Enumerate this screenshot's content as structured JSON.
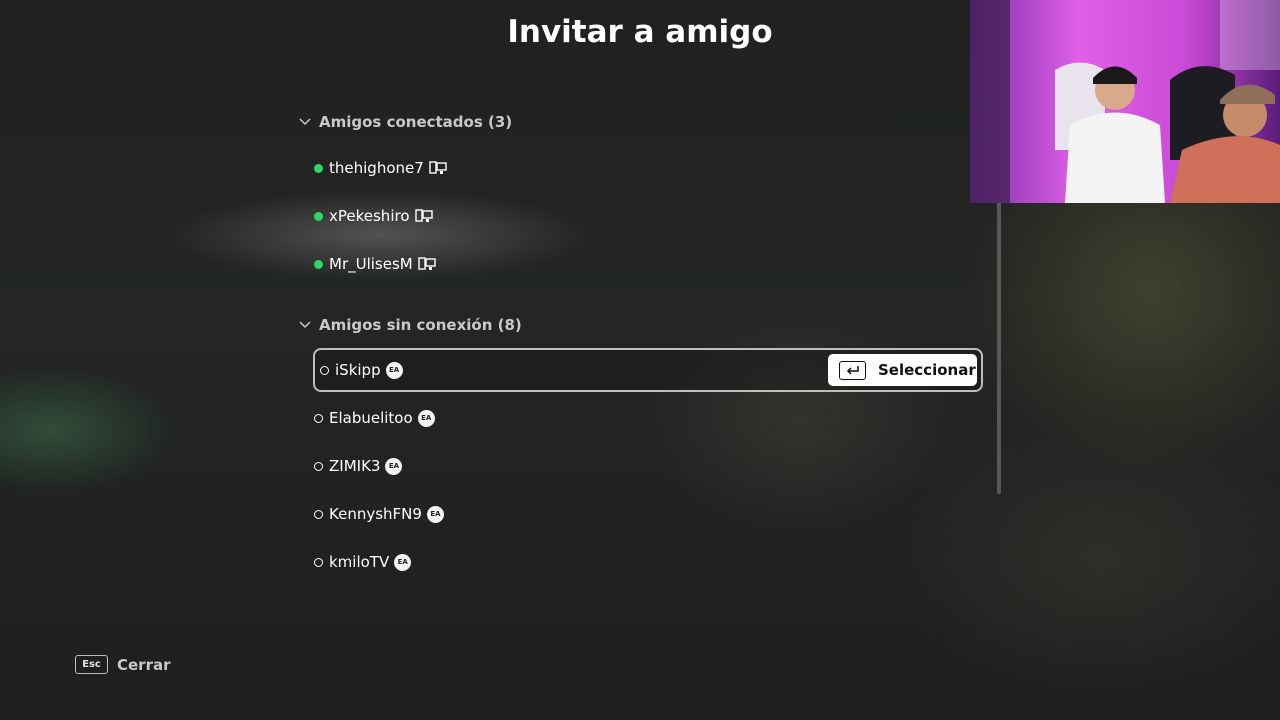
{
  "title": "Invitar a amigo",
  "sections": [
    {
      "header": "Amigos conectados (3)",
      "friends": [
        {
          "name": "thehighone7",
          "status": "online",
          "platform_icon": "pc-icon"
        },
        {
          "name": "xPekeshiro",
          "status": "online",
          "platform_icon": "pc-icon"
        },
        {
          "name": "Mr_UlisesM",
          "status": "online",
          "platform_icon": "pc-icon"
        }
      ]
    },
    {
      "header": "Amigos sin conexión (8)",
      "friends": [
        {
          "name": "iSkipp",
          "status": "offline",
          "platform_icon": "ea-icon",
          "selected": true
        },
        {
          "name": "Elabuelitoo",
          "status": "offline",
          "platform_icon": "ea-icon"
        },
        {
          "name": "ZIMIK3",
          "status": "offline",
          "platform_icon": "ea-icon"
        },
        {
          "name": "KennyshFN9",
          "status": "offline",
          "platform_icon": "ea-icon"
        },
        {
          "name": "kmiloTV",
          "status": "offline",
          "platform_icon": "ea-icon"
        }
      ]
    }
  ],
  "select_button": {
    "label": "Seleccionar",
    "key_icon": "enter-key-icon"
  },
  "footer": {
    "key": "Esc",
    "label": "Cerrar"
  },
  "ea_badge_text": "EA",
  "colors": {
    "online": "#2bd86b",
    "highlight_border": "#bfbfbf",
    "button_bg": "#ffffff"
  }
}
